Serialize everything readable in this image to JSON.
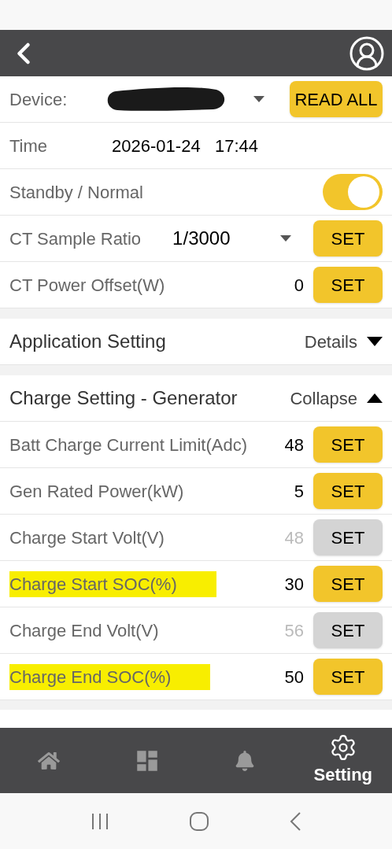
{
  "header": {
    "has_back": true
  },
  "top_rows": [
    {
      "kind": "device",
      "label": "Device:",
      "redacted": true,
      "button": "READ ALL"
    },
    {
      "kind": "text",
      "label": "Time",
      "value": "2026-01-24   17:44"
    },
    {
      "kind": "toggle",
      "label": "Standby / Normal",
      "on": true
    },
    {
      "kind": "select",
      "label": "CT Sample Ratio",
      "value": "1/3000",
      "button": "SET",
      "disabled": false
    },
    {
      "kind": "value",
      "label": "CT Power Offset(W)",
      "value": "0",
      "button": "SET",
      "disabled": false
    }
  ],
  "sections": [
    {
      "title": "Application Setting",
      "action": "Details",
      "expanded": false
    },
    {
      "title": "Charge Setting - Generator",
      "action": "Collapse",
      "expanded": true,
      "rows": [
        {
          "label": "Batt Charge Current Limit(Adc)",
          "value": "48",
          "button": "SET",
          "disabled": false,
          "highlighted": false
        },
        {
          "label": "Gen Rated Power(kW)",
          "value": "5",
          "button": "SET",
          "disabled": false,
          "highlighted": false
        },
        {
          "label": "Charge Start Volt(V)",
          "value": "48",
          "button": "SET",
          "disabled": true,
          "highlighted": false
        },
        {
          "label": "Charge Start SOC(%)",
          "value": "30",
          "button": "SET",
          "disabled": false,
          "highlighted": true
        },
        {
          "label": "Charge End Volt(V)",
          "value": "56",
          "button": "SET",
          "disabled": true,
          "highlighted": false
        },
        {
          "label": "Charge End SOC(%)",
          "value": "50",
          "button": "SET",
          "disabled": false,
          "highlighted": true
        }
      ]
    }
  ],
  "bottom_nav": [
    {
      "kind": "home",
      "selected": false
    },
    {
      "kind": "dashboard",
      "selected": false
    },
    {
      "kind": "alerts",
      "selected": false
    },
    {
      "kind": "settings",
      "label": "Setting",
      "selected": true
    }
  ]
}
